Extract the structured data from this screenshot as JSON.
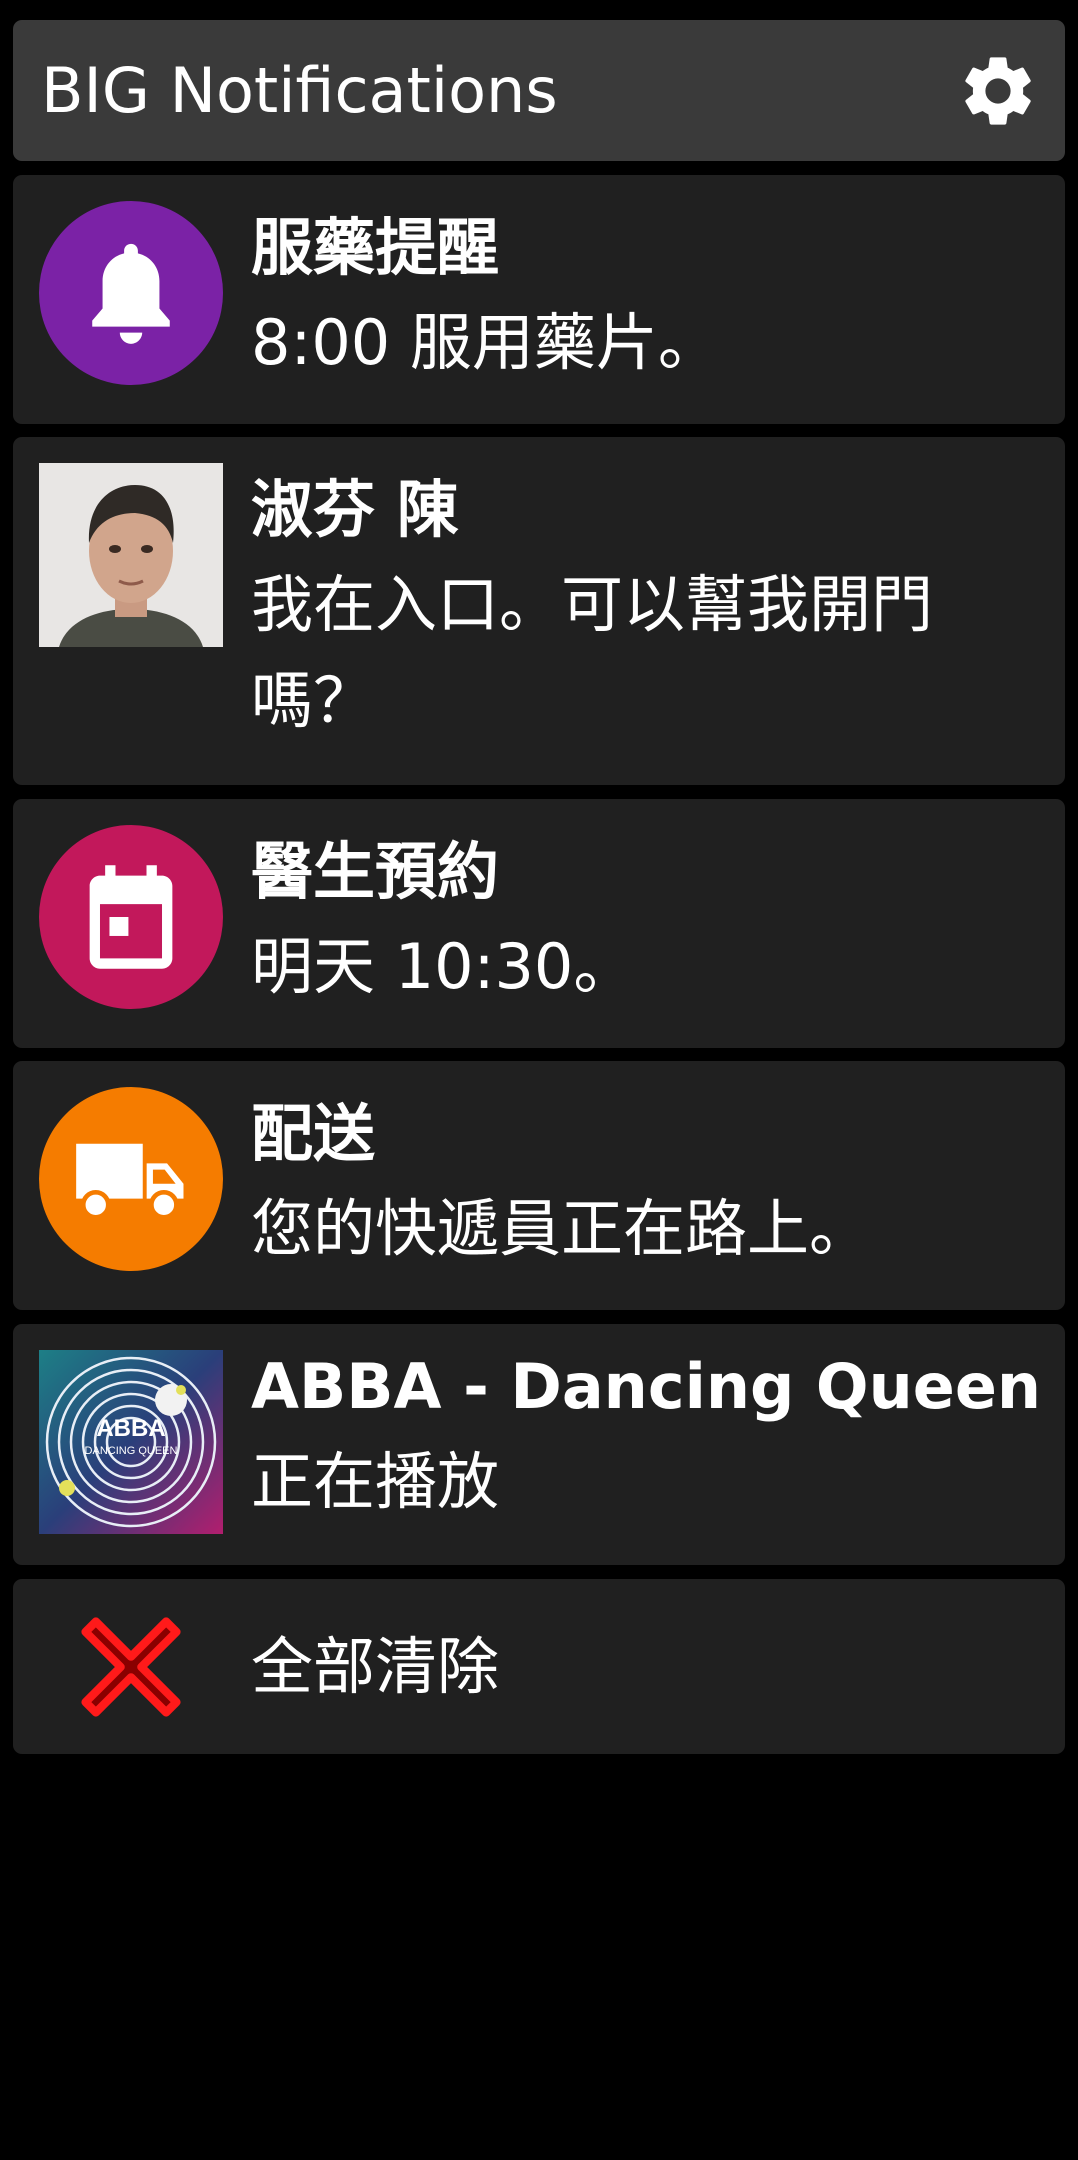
{
  "header": {
    "title": "BIG Notifications",
    "settings_icon": "gear-icon"
  },
  "notifications": [
    {
      "icon": "bell-icon",
      "icon_color": "#7b22a6",
      "title": "服藥提醒",
      "body": "8:00 服用藥片。"
    },
    {
      "icon": "contact-photo",
      "title": "淑芬 陳",
      "body": "我在入口。可以幫我開門嗎？"
    },
    {
      "icon": "calendar-icon",
      "icon_color": "#c2185b",
      "title": "醫生預約",
      "body": "明天 10:30。"
    },
    {
      "icon": "truck-icon",
      "icon_color": "#f57c00",
      "title": "配送",
      "body": "您的快遞員正在路上。"
    },
    {
      "icon": "album-art",
      "album_art_text": [
        "ABBA",
        "DANCING QUEEN"
      ],
      "title": "ABBA - Dancing Queen",
      "body": "正在播放"
    }
  ],
  "clear_all": {
    "label": "全部清除",
    "icon": "close-icon",
    "icon_color": "#d50000"
  },
  "colors": {
    "background": "#000000",
    "header_bg": "#3a3a3a",
    "card_bg": "#202020",
    "text": "#ffffff"
  }
}
